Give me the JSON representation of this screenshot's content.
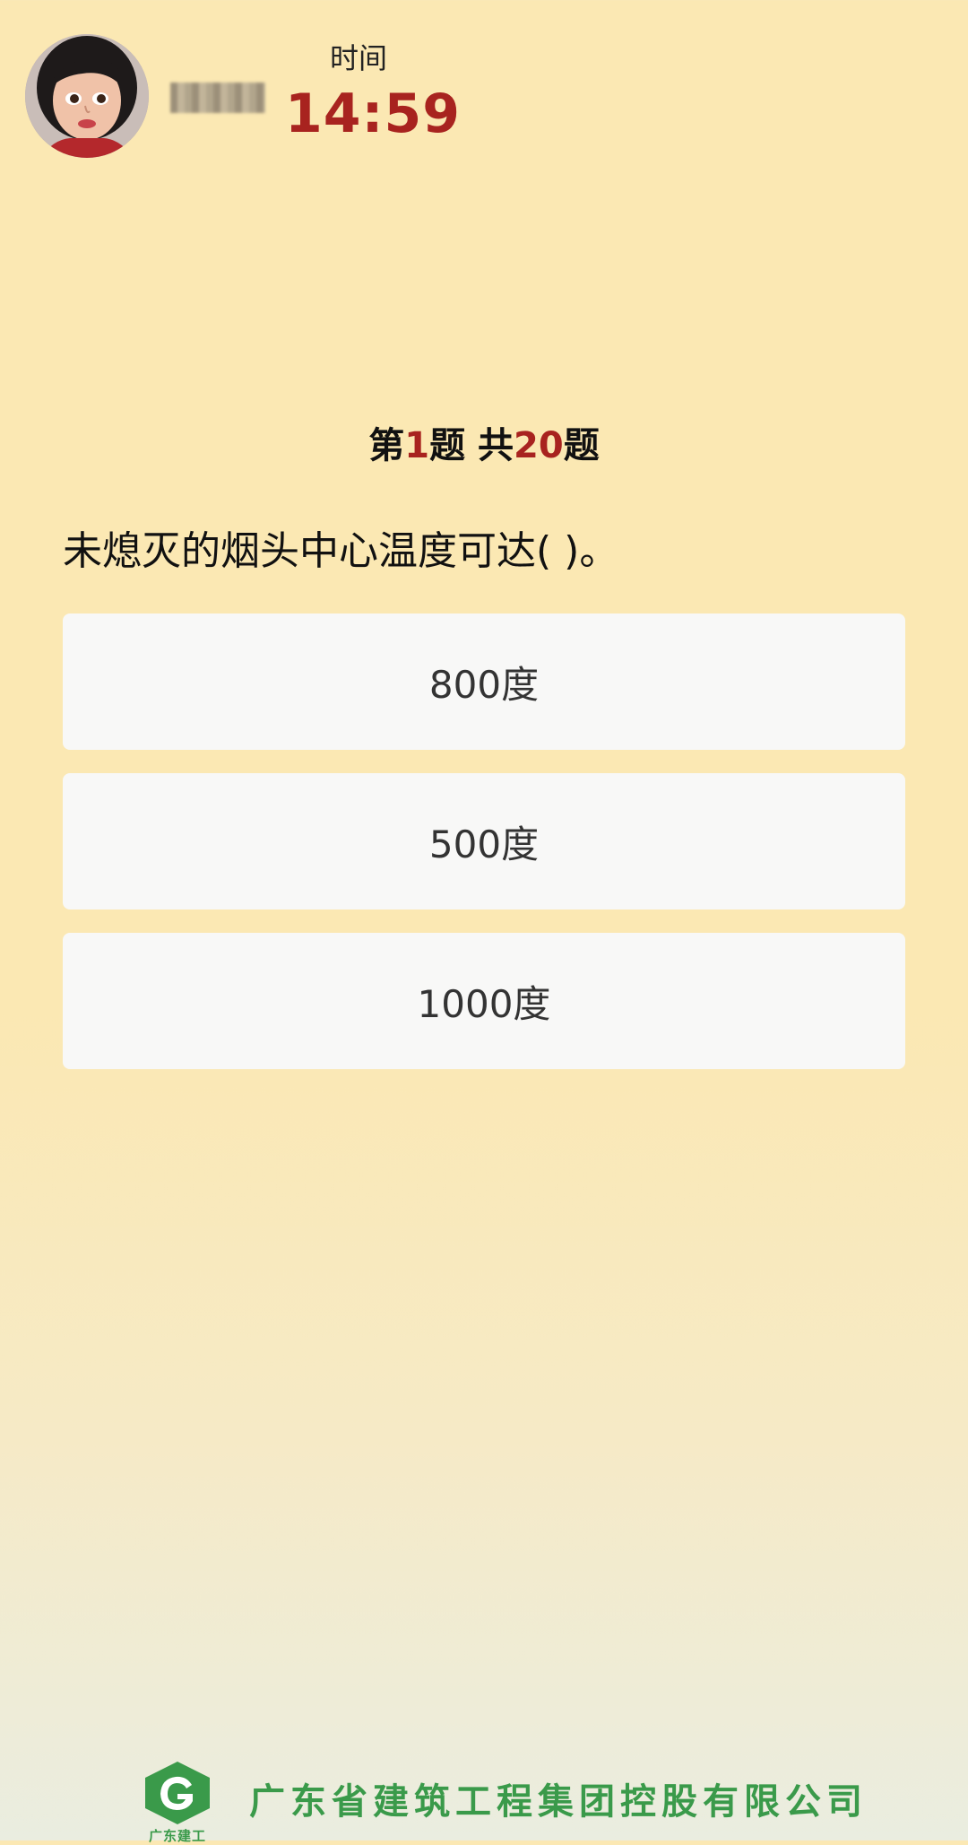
{
  "header": {
    "avatar_icon": "user-avatar-icon",
    "timer_label": "时间",
    "timer_value": "14:59"
  },
  "quiz": {
    "counter_prefix": "第",
    "current": "1",
    "counter_mid": "题 共",
    "total": "20",
    "counter_suffix": "题",
    "question": "未熄灭的烟头中心温度可达( )。",
    "options": [
      {
        "label": "800度"
      },
      {
        "label": "500度"
      },
      {
        "label": "1000度"
      }
    ]
  },
  "footer": {
    "logo_icon": "company-logo-icon",
    "logo_subtext": "广东建工",
    "company_name": "广东省建筑工程集团控股有限公司"
  },
  "colors": {
    "accent_red": "#a8231f",
    "brand_green": "#3a9a4a",
    "background": "#fbe8b3"
  }
}
